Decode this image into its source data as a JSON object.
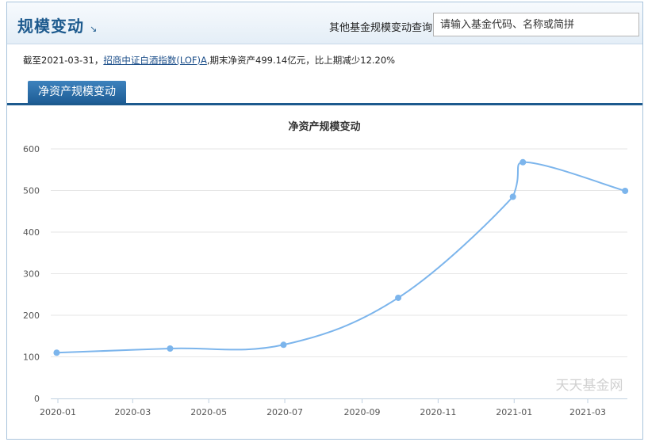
{
  "header": {
    "title": "规模变动",
    "title_arrow": "↘",
    "query_label": "其他基金规模变动查询:",
    "search_placeholder": "请输入基金代码、名称或简拼"
  },
  "info": {
    "prefix": "截至2021-03-31，",
    "fund_link": "招商中证白酒指数(LOF)A",
    "suffix": ",期末净资产499.14亿元，比上期减少12.20%"
  },
  "tabs": [
    {
      "label": "净资产规模变动",
      "active": true
    }
  ],
  "watermark": "天天基金网",
  "chart_data": {
    "type": "line",
    "title": "净资产规模变动",
    "xlabel": "",
    "ylabel": "",
    "x_ticks": [
      "2020-01",
      "2020-03",
      "2020-05",
      "2020-07",
      "2020-09",
      "2020-11",
      "2021-01",
      "2021-03"
    ],
    "y_ticks": [
      0,
      100,
      200,
      300,
      400,
      500,
      600
    ],
    "ylim": [
      0,
      600
    ],
    "grid": true,
    "color": "#7cb5ec",
    "points": [
      {
        "x": "2019-12-31",
        "y": 110
      },
      {
        "x": "2020-03-31",
        "y": 120
      },
      {
        "x": "2020-06-30",
        "y": 129
      },
      {
        "x": "2020-09-30",
        "y": 242
      },
      {
        "x": "2020-12-31",
        "y": 485
      },
      {
        "x": "2021-01-08",
        "y": 568
      },
      {
        "x": "2021-03-31",
        "y": 499.14
      }
    ]
  }
}
